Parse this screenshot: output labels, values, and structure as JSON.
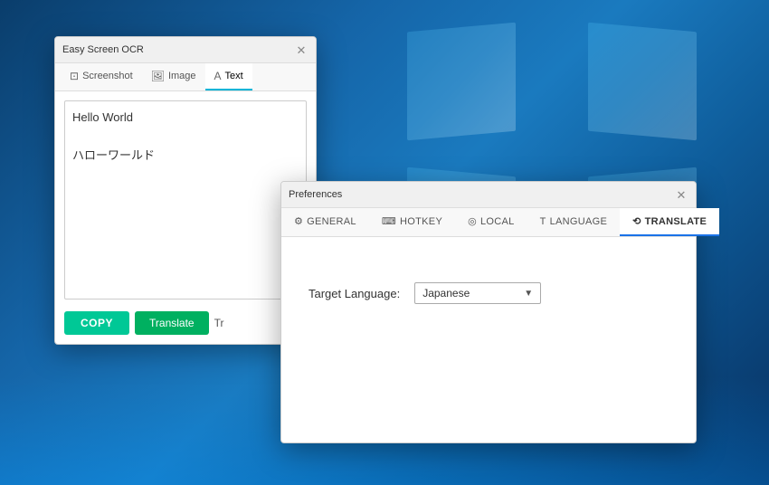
{
  "desktop": {
    "background": "#1565a8"
  },
  "ocr_window": {
    "title": "Easy Screen OCR",
    "tabs": [
      {
        "id": "screenshot",
        "label": "Screenshot",
        "icon": "screenshot-icon",
        "active": false
      },
      {
        "id": "image",
        "label": "Image",
        "icon": "image-icon",
        "active": false
      },
      {
        "id": "text",
        "label": "Text",
        "icon": "text-icon",
        "active": true
      }
    ],
    "textarea_content_line1": "Hello World",
    "textarea_content_line2": "ハローワールド",
    "buttons": {
      "copy_label": "COPY",
      "translate_label": "Translate",
      "more_label": "Tr"
    }
  },
  "preferences_window": {
    "title": "Preferences",
    "tabs": [
      {
        "id": "general",
        "label": "GENERAL",
        "icon": "gear-icon",
        "active": false
      },
      {
        "id": "hotkey",
        "label": "HOTKEY",
        "icon": "keyboard-icon",
        "active": false
      },
      {
        "id": "local",
        "label": "LOCAL",
        "icon": "globe-icon",
        "active": false
      },
      {
        "id": "language",
        "label": "LANGUAGE",
        "icon": "text-lang-icon",
        "active": false
      },
      {
        "id": "translate",
        "label": "TRANSLATE",
        "icon": "translate-icon",
        "active": true
      }
    ],
    "content": {
      "target_language_label": "Target Language:",
      "selected_language": "Japanese",
      "select_placeholder": "Japanese"
    }
  }
}
